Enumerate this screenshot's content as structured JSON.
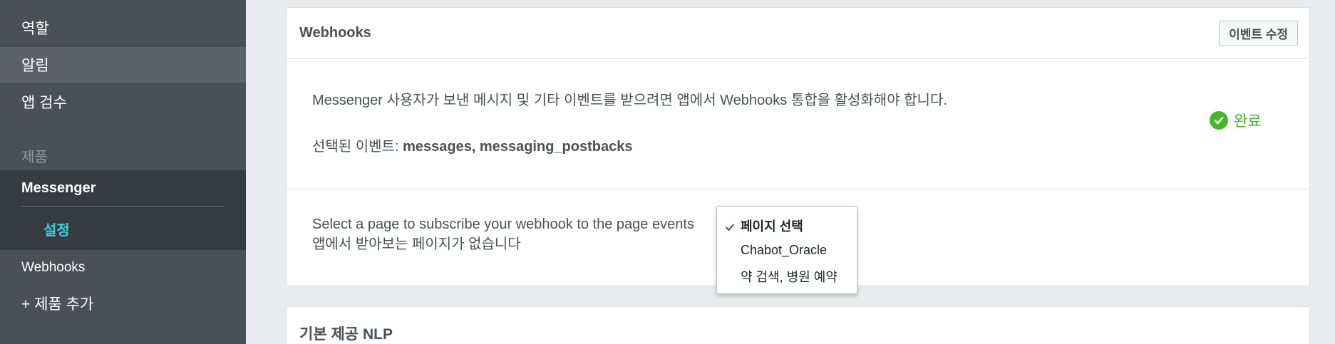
{
  "sidebar": {
    "items": [
      {
        "label": "역할"
      },
      {
        "label": "알림"
      },
      {
        "label": "앱 검수"
      }
    ],
    "products_heading": "제품",
    "messenger": {
      "title": "Messenger",
      "sub_label": "설정"
    },
    "webhooks_label": "Webhooks",
    "add_product_label": "+ 제품 추가"
  },
  "webhooks_card": {
    "title": "Webhooks",
    "edit_button_label": "이벤트 수정",
    "description": "Messenger 사용자가 보낸 메시지 및 기타 이벤트를 받으려면 앱에서 Webhooks 통합을 활성화해야 합니다.",
    "selected_events_prefix": "선택된 이벤트: ",
    "selected_events": "messages, messaging_postbacks",
    "status_label": "완료",
    "subscribe_text": "Select a page to subscribe your webhook to the page events",
    "no_pages_text": "앱에서 받아보는 페이지가 없습니다"
  },
  "page_dropdown": {
    "options": [
      {
        "label": "페이지 선택",
        "selected": true
      },
      {
        "label": "Chabot_Oracle",
        "selected": false
      },
      {
        "label": "약 검색, 병원 예약",
        "selected": false
      }
    ]
  },
  "nlp_card": {
    "title": "기본 제공 NLP"
  },
  "colors": {
    "sidebar_bg": "#4b4f56",
    "sidebar_active_bg": "#363a41",
    "accent_cyan": "#39d0e0",
    "success_green": "#42b72a"
  },
  "icons": {
    "status": "check-circle-icon",
    "selected_option": "checkmark-icon"
  }
}
